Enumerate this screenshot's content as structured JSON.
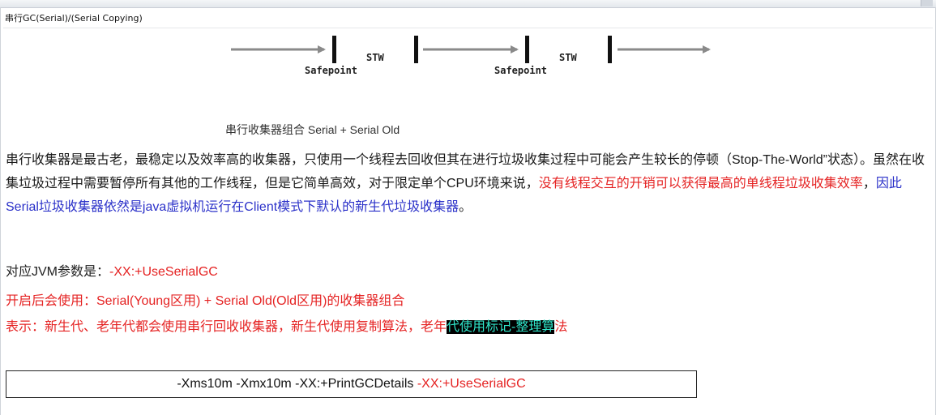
{
  "window": {
    "title": "串行GC(Serial)/(Serial Copying)"
  },
  "diagram": {
    "labels": [
      "Safepoint",
      "STW",
      "Safepoint",
      "STW"
    ],
    "arrow_color": "#8a8a8a",
    "bar_color": "#111111"
  },
  "caption": "串行收集器组合 Serial + Serial Old",
  "paragraph": {
    "part1": "串行收集器是最古老，最稳定以及效率高的收集器，只使用一个线程去回收但其在进行垃圾收集过程中可能会产生较长的停顿（Stop-The-World”状态）。虽然在收集垃圾过程中需要暂停所有其他的工作线程，但是它简单高效，对于限定单个CPU环境来说，",
    "part2_red": "没有线程交互的开销可以获得最高的单线程垃圾收集效率",
    "part3": "，",
    "part4_blue": "因此Serial垃圾收集器依然是java虚拟机运行在Client模式下默认的新生代垃圾收集器",
    "part5": "。"
  },
  "jvm_param": {
    "label": "对应JVM参数是：",
    "value": "-XX:+UseSerialGC"
  },
  "after_enable": "开启后会使用：Serial(Young区用) + Serial Old(Old区用)的收集器组合",
  "meaning": {
    "prefix": "表示：新生代、老年代都会使用串行回收收集器，新生代使用复制算法，老年",
    "highlight": "代使用标记-整理算",
    "suffix": "法"
  },
  "command": {
    "normal": "-Xms10m -Xmx10m -XX:+PrintGCDetails ",
    "red": "-XX:+UseSerialGC"
  },
  "colors": {
    "red": "#e52323",
    "blue": "#2b31c9",
    "highlight_bg": "#000000",
    "highlight_fg": "#2fe3c8"
  }
}
